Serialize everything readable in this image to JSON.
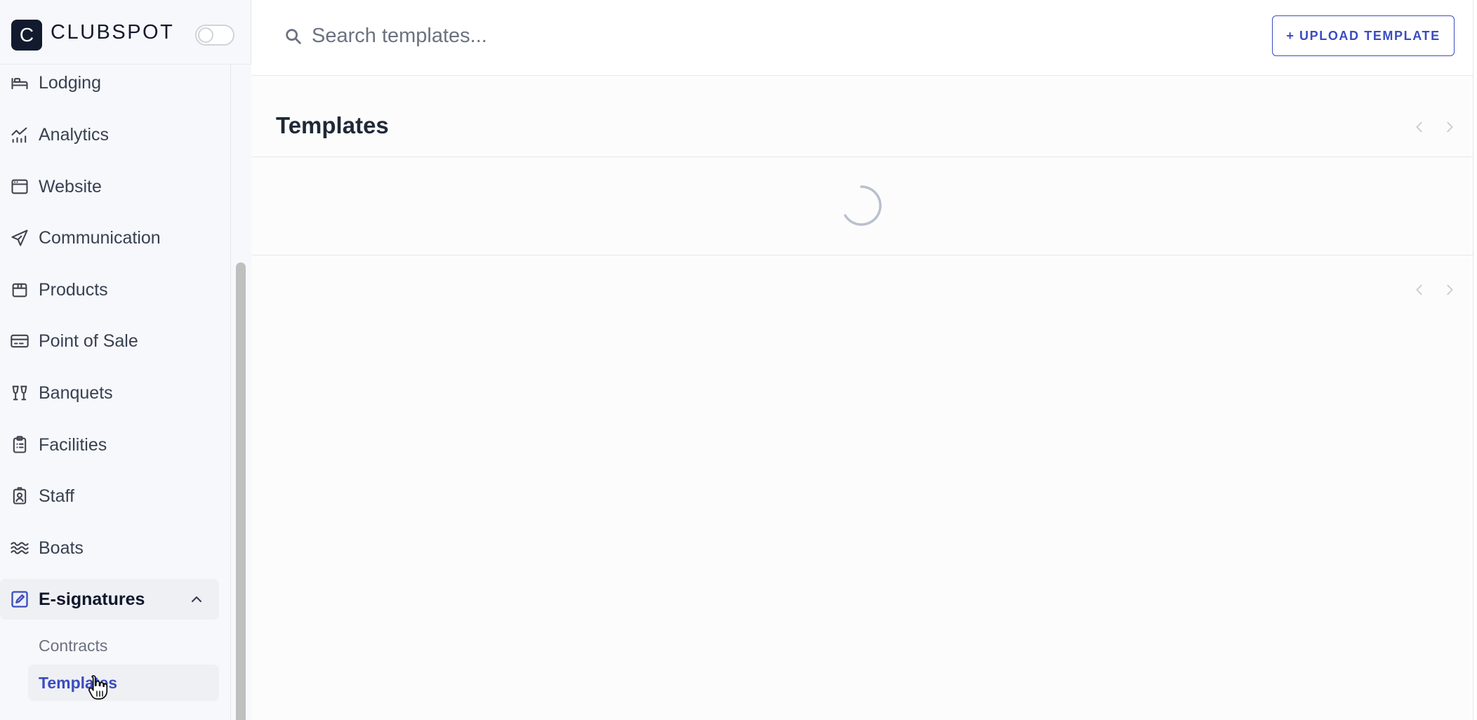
{
  "brand": {
    "logo_letter": "C",
    "name": "CLUBSPOT"
  },
  "sidebar": {
    "items": [
      {
        "label": "Lodging",
        "icon": "bed-icon"
      },
      {
        "label": "Analytics",
        "icon": "chart-icon"
      },
      {
        "label": "Website",
        "icon": "browser-window-icon"
      },
      {
        "label": "Communication",
        "icon": "paper-plane-icon"
      },
      {
        "label": "Products",
        "icon": "box-icon"
      },
      {
        "label": "Point of Sale",
        "icon": "credit-card-icon"
      },
      {
        "label": "Banquets",
        "icon": "cheers-glasses-icon"
      },
      {
        "label": "Facilities",
        "icon": "clipboard-icon"
      },
      {
        "label": "Staff",
        "icon": "badge-icon"
      },
      {
        "label": "Boats",
        "icon": "waves-icon"
      },
      {
        "label": "E-signatures",
        "icon": "signature-edit-icon",
        "active": true,
        "expanded": true
      }
    ],
    "subitems": [
      {
        "label": "Contracts"
      },
      {
        "label": "Templates",
        "selected": true
      }
    ]
  },
  "topbar": {
    "search_placeholder": "Search templates...",
    "upload_label": "+ UPLOAD TEMPLATE"
  },
  "main": {
    "title": "Templates",
    "status": "loading"
  },
  "colors": {
    "accent": "#3b4cc0",
    "logo_bg": "#121a2e",
    "sidebar_bg": "#f7f8fb"
  }
}
